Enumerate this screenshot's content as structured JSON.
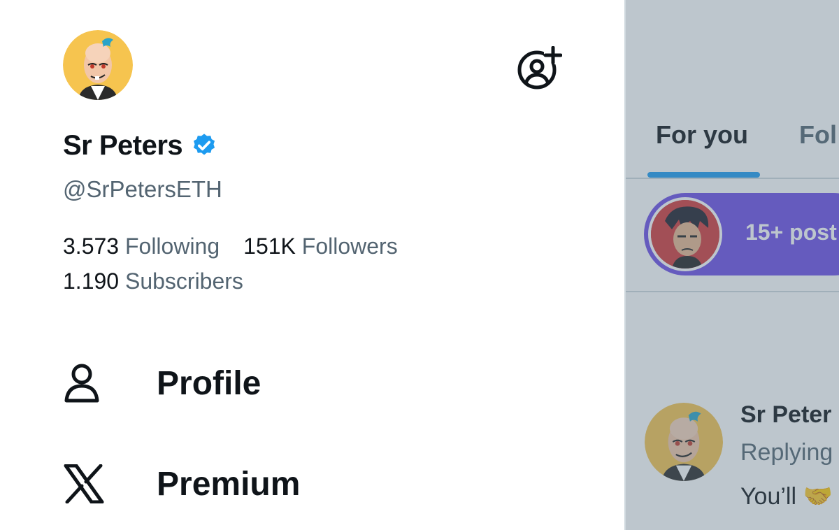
{
  "drawer": {
    "account": {
      "display_name": "Sr Peters",
      "handle": "@SrPetersETH",
      "verified": true
    },
    "stats": {
      "following_count": "3.573",
      "following_label": "Following",
      "followers_count": "151K",
      "followers_label": "Followers",
      "subscribers_count": "1.190",
      "subscribers_label": "Subscribers"
    },
    "nav": [
      {
        "label": "Profile",
        "icon": "person-icon"
      },
      {
        "label": "Premium",
        "icon": "x-logo-icon"
      }
    ],
    "add_account_icon": "add-account-icon"
  },
  "timeline": {
    "tabs": [
      {
        "label": "For you",
        "active": true
      },
      {
        "label": "Fol",
        "active": false
      }
    ],
    "new_posts_pill": "15+ post",
    "post": {
      "author": "Sr Peter",
      "reply_text": "Replying",
      "body": "You’ll 🤝"
    }
  },
  "colors": {
    "accent": "#1d9bf0",
    "verified_badge": "#1d9bf0",
    "text_primary": "#0f1419",
    "text_secondary": "#536471",
    "pill": "#6d4de6",
    "avatar_bg": "#f6c44f"
  }
}
